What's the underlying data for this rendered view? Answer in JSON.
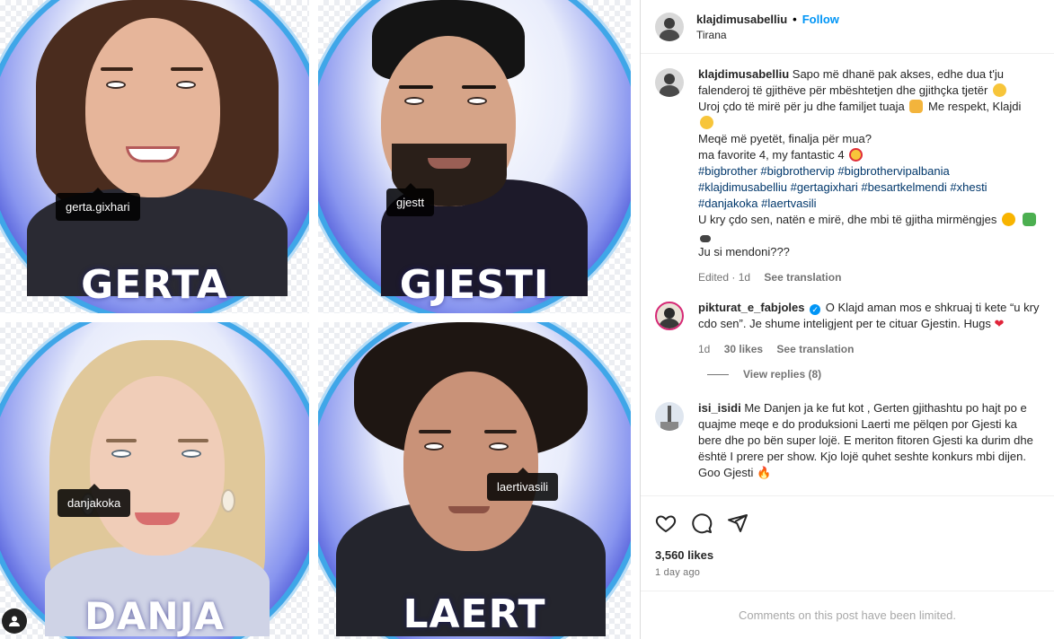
{
  "post_media": {
    "cards": [
      {
        "name": "GERTA",
        "tag": "gerta.gixhari"
      },
      {
        "name": "GJESTI",
        "tag": "gjestt"
      },
      {
        "name": "DANJA",
        "tag": "danjakoka"
      },
      {
        "name": "LAERT",
        "tag": "laertivasili"
      }
    ]
  },
  "header": {
    "username": "klajdimusabelliu",
    "separator": "•",
    "follow_label": "Follow",
    "location": "Tirana"
  },
  "caption": {
    "username": "klajdimusabelliu",
    "line1": "Sapo më dhanë pak akses, edhe dua t'ju falenderoj të gjithëve për mbështetjen dhe gjithçka tjetër",
    "line2": "Uroj çdo të mirë për ju dhe familjet tuaja",
    "line2b": "Me respekt, Klajdi",
    "line3": "Meqë më pyetët, finalja për mua?",
    "line4": "ma favorite 4, my fantastic 4",
    "hashtags1": "#bigbrother #bigbrothervip #bigbrothervipalbania",
    "hashtags2": "#klajdimusabelliu #gertagixhari #besartkelmendi #xhesti",
    "hashtags3": "#danjakoka #laertvasili",
    "line5": "U kry çdo sen, natën e mirë, dhe mbi të gjitha mirmëngjes",
    "line6": "Ju si mendoni???",
    "edited": "Edited · 1d",
    "see_translation": "See translation"
  },
  "comment1": {
    "username": "pikturat_e_fabjoles",
    "verified_mark": "✓",
    "text": "O Klajd aman mos e shkruaj ti kete “u kry cdo sen”. Je shume inteligjent per te cituar Gjestin. Hugs",
    "age": "1d",
    "likes": "30 likes",
    "see_translation": "See translation",
    "view_replies": "View replies (8)"
  },
  "comment2": {
    "username": "isi_isidi",
    "text": "Me Danjen ja ke fut kot , Gerten gjithashtu po hajt po e quajme meqe e do produksioni Laerti me pëlqen por Gjesti ka bere dhe po bën super lojë. E meriton fitoren Gjesti ka durim dhe është I prere per show. Kjo lojë quhet seshte konkurs mbi dijen. Goo Gjesti"
  },
  "actions": {
    "likes": "3,560 likes",
    "age": "1 day ago",
    "limited_notice": "Comments on this post have been limited."
  },
  "icons": [
    "heart-icon",
    "comment-icon",
    "share-icon",
    "user-tag-icon"
  ],
  "colors": {
    "link": "#0095f6",
    "hashtag": "#00376b",
    "muted": "#737373",
    "badge_blue": "#2a33c9"
  }
}
